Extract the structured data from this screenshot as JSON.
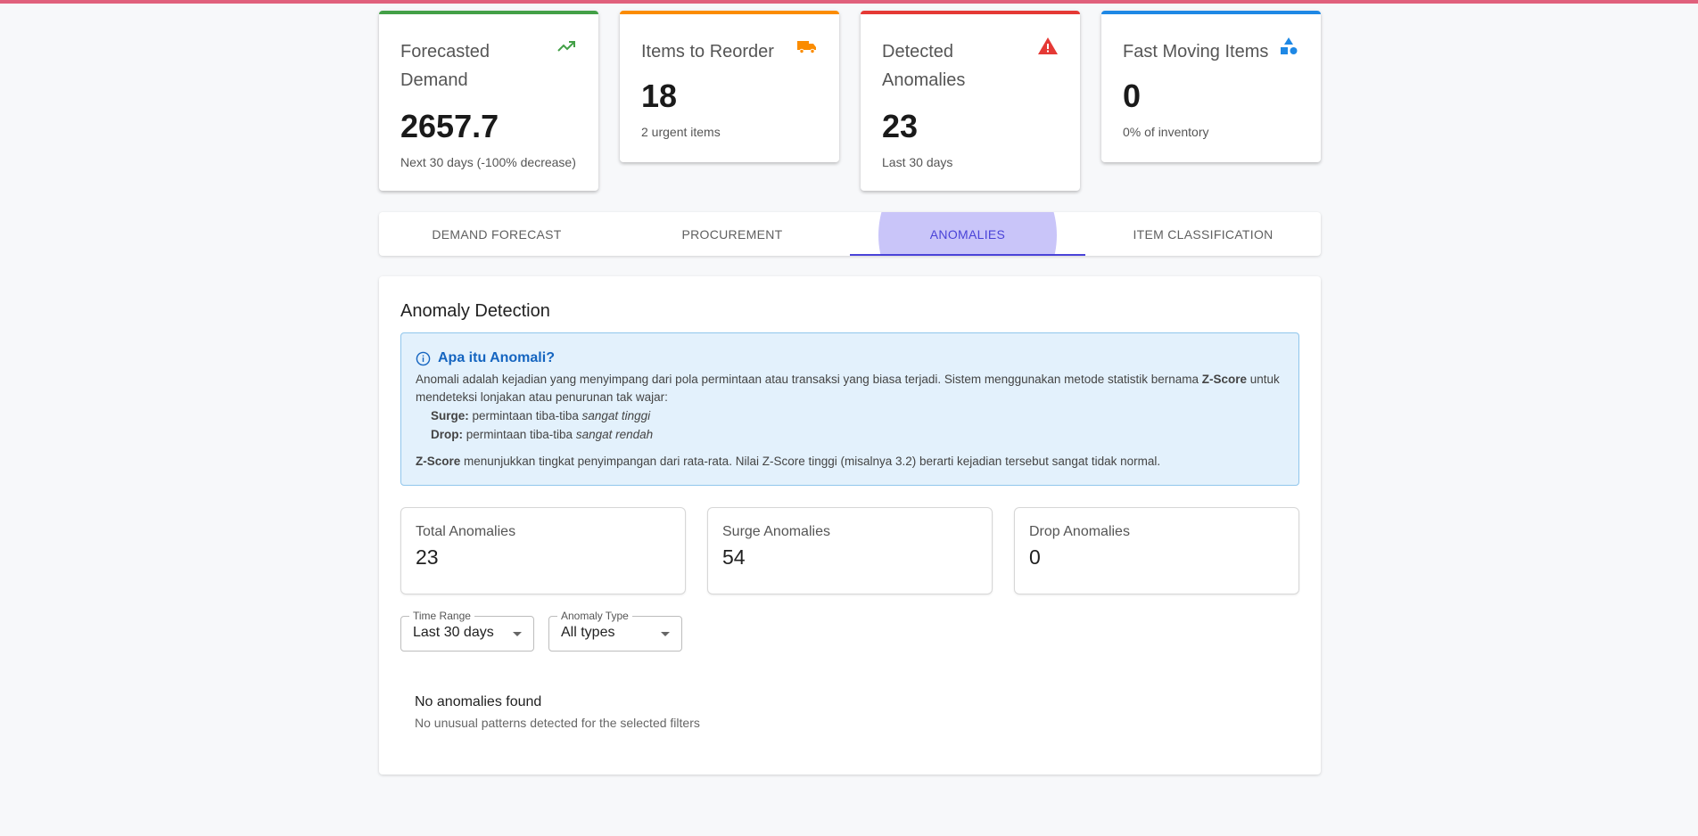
{
  "kpis": [
    {
      "title": "Forecasted Demand",
      "value": "2657.7",
      "sub": "Next 30 days (-100% decrease)",
      "icon": "trending-up-icon",
      "accent": "#43a047"
    },
    {
      "title": "Items to Reorder",
      "value": "18",
      "sub": "2 urgent items",
      "icon": "truck-icon",
      "accent": "#fb8c00"
    },
    {
      "title": "Detected Anomalies",
      "value": "23",
      "sub": "Last 30 days",
      "icon": "warning-icon",
      "accent": "#e53935"
    },
    {
      "title": "Fast Moving Items",
      "value": "0",
      "sub": "0% of inventory",
      "icon": "category-shapes-icon",
      "accent": "#1e88e5"
    }
  ],
  "tabs": [
    "DEMAND FORECAST",
    "PROCUREMENT",
    "ANOMALIES",
    "ITEM CLASSIFICATION"
  ],
  "active_tab": "ANOMALIES",
  "panel": {
    "title": "Anomaly Detection",
    "info": {
      "heading": "Apa itu Anomali?",
      "p1_a": "Anomali adalah kejadian yang menyimpang dari pola permintaan atau transaksi yang biasa terjadi. Sistem menggunakan metode statistik bernama ",
      "p1_b": "Z-Score",
      "p1_c": " untuk mendeteksi lonjakan atau penurunan tak wajar:",
      "surge_label": "Surge:",
      "surge_text": " permintaan tiba-tiba ",
      "surge_em": "sangat tinggi",
      "drop_label": "Drop:",
      "drop_text": " permintaan tiba-tiba ",
      "drop_em": "sangat rendah",
      "foot_b": "Z-Score",
      "foot_text": " menunjukkan tingkat penyimpangan dari rata-rata. Nilai Z-Score tinggi (misalnya 3.2) berarti kejadian tersebut sangat tidak normal."
    },
    "stats": [
      {
        "label": "Total Anomalies",
        "value": "23"
      },
      {
        "label": "Surge Anomalies",
        "value": "54"
      },
      {
        "label": "Drop Anomalies",
        "value": "0"
      }
    ],
    "filters": {
      "time_range": {
        "label": "Time Range",
        "value": "Last 30 days"
      },
      "anomaly_type": {
        "label": "Anomaly Type",
        "value": "All types"
      }
    },
    "empty": {
      "title": "No anomalies found",
      "sub": "No unusual patterns detected for the selected filters"
    }
  }
}
